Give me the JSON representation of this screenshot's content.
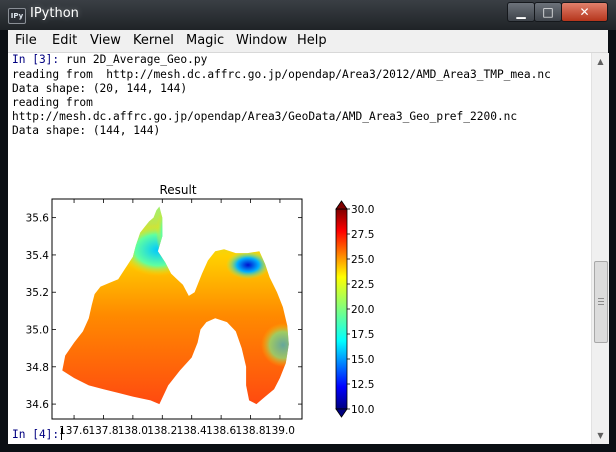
{
  "window": {
    "title": "IPython",
    "app_icon_text": "IPy"
  },
  "menu": [
    "File",
    "Edit",
    "View",
    "Kernel",
    "Magic",
    "Window",
    "Help"
  ],
  "console": {
    "prompt1": "In [3]:",
    "cmd1": "run 2D_Average_Geo.py",
    "out1": "reading from  http://mesh.dc.affrc.go.jp/opendap/Area3/2012/AMD_Area3_TMP_mea.nc",
    "out2": "Data shape: (20, 144, 144)",
    "out3": "reading from",
    "out4": "http://mesh.dc.affrc.go.jp/opendap/Area3/GeoData/AMD_Area3_Geo_pref_2200.nc",
    "out5": "Data shape: (144, 144)",
    "prompt2": "In [4]:"
  },
  "chart_data": {
    "type": "heatmap",
    "title": "Result",
    "xlabel": "",
    "ylabel": "",
    "xlim": [
      137.45,
      139.15
    ],
    "ylim": [
      34.52,
      35.7
    ],
    "x_ticks": [
      "137.6",
      "137.8",
      "138.0",
      "138.2",
      "138.4",
      "138.6",
      "138.8",
      "139.0"
    ],
    "y_ticks": [
      "35.6",
      "35.4",
      "35.2",
      "35.0",
      "34.8",
      "34.6"
    ],
    "colorbar": {
      "min": 10.0,
      "max": 30.0,
      "ticks": [
        "30.0",
        "27.5",
        "25.0",
        "22.5",
        "20.0",
        "17.5",
        "15.0",
        "12.5",
        "10.0"
      ],
      "colormap": "jet"
    }
  }
}
